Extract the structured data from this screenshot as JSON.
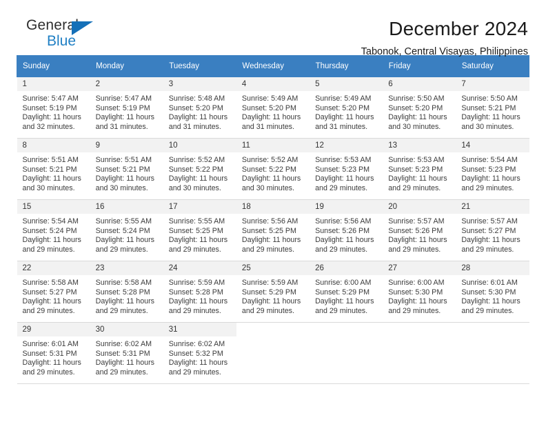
{
  "brand": {
    "name_line1": "General",
    "name_line2": "Blue",
    "accent_color": "#1570b8"
  },
  "header": {
    "title": "December 2024",
    "subtitle": "Tabonok, Central Visayas, Philippines"
  },
  "calendar": {
    "header_bg": "#3a7fc1",
    "daynum_bg": "#f2f2f2",
    "weekdays": [
      "Sunday",
      "Monday",
      "Tuesday",
      "Wednesday",
      "Thursday",
      "Friday",
      "Saturday"
    ],
    "weeks": [
      [
        {
          "day": "1",
          "sunrise": "Sunrise: 5:47 AM",
          "sunset": "Sunset: 5:19 PM",
          "daylight1": "Daylight: 11 hours",
          "daylight2": "and 32 minutes."
        },
        {
          "day": "2",
          "sunrise": "Sunrise: 5:47 AM",
          "sunset": "Sunset: 5:19 PM",
          "daylight1": "Daylight: 11 hours",
          "daylight2": "and 31 minutes."
        },
        {
          "day": "3",
          "sunrise": "Sunrise: 5:48 AM",
          "sunset": "Sunset: 5:20 PM",
          "daylight1": "Daylight: 11 hours",
          "daylight2": "and 31 minutes."
        },
        {
          "day": "4",
          "sunrise": "Sunrise: 5:49 AM",
          "sunset": "Sunset: 5:20 PM",
          "daylight1": "Daylight: 11 hours",
          "daylight2": "and 31 minutes."
        },
        {
          "day": "5",
          "sunrise": "Sunrise: 5:49 AM",
          "sunset": "Sunset: 5:20 PM",
          "daylight1": "Daylight: 11 hours",
          "daylight2": "and 31 minutes."
        },
        {
          "day": "6",
          "sunrise": "Sunrise: 5:50 AM",
          "sunset": "Sunset: 5:20 PM",
          "daylight1": "Daylight: 11 hours",
          "daylight2": "and 30 minutes."
        },
        {
          "day": "7",
          "sunrise": "Sunrise: 5:50 AM",
          "sunset": "Sunset: 5:21 PM",
          "daylight1": "Daylight: 11 hours",
          "daylight2": "and 30 minutes."
        }
      ],
      [
        {
          "day": "8",
          "sunrise": "Sunrise: 5:51 AM",
          "sunset": "Sunset: 5:21 PM",
          "daylight1": "Daylight: 11 hours",
          "daylight2": "and 30 minutes."
        },
        {
          "day": "9",
          "sunrise": "Sunrise: 5:51 AM",
          "sunset": "Sunset: 5:21 PM",
          "daylight1": "Daylight: 11 hours",
          "daylight2": "and 30 minutes."
        },
        {
          "day": "10",
          "sunrise": "Sunrise: 5:52 AM",
          "sunset": "Sunset: 5:22 PM",
          "daylight1": "Daylight: 11 hours",
          "daylight2": "and 30 minutes."
        },
        {
          "day": "11",
          "sunrise": "Sunrise: 5:52 AM",
          "sunset": "Sunset: 5:22 PM",
          "daylight1": "Daylight: 11 hours",
          "daylight2": "and 30 minutes."
        },
        {
          "day": "12",
          "sunrise": "Sunrise: 5:53 AM",
          "sunset": "Sunset: 5:23 PM",
          "daylight1": "Daylight: 11 hours",
          "daylight2": "and 29 minutes."
        },
        {
          "day": "13",
          "sunrise": "Sunrise: 5:53 AM",
          "sunset": "Sunset: 5:23 PM",
          "daylight1": "Daylight: 11 hours",
          "daylight2": "and 29 minutes."
        },
        {
          "day": "14",
          "sunrise": "Sunrise: 5:54 AM",
          "sunset": "Sunset: 5:23 PM",
          "daylight1": "Daylight: 11 hours",
          "daylight2": "and 29 minutes."
        }
      ],
      [
        {
          "day": "15",
          "sunrise": "Sunrise: 5:54 AM",
          "sunset": "Sunset: 5:24 PM",
          "daylight1": "Daylight: 11 hours",
          "daylight2": "and 29 minutes."
        },
        {
          "day": "16",
          "sunrise": "Sunrise: 5:55 AM",
          "sunset": "Sunset: 5:24 PM",
          "daylight1": "Daylight: 11 hours",
          "daylight2": "and 29 minutes."
        },
        {
          "day": "17",
          "sunrise": "Sunrise: 5:55 AM",
          "sunset": "Sunset: 5:25 PM",
          "daylight1": "Daylight: 11 hours",
          "daylight2": "and 29 minutes."
        },
        {
          "day": "18",
          "sunrise": "Sunrise: 5:56 AM",
          "sunset": "Sunset: 5:25 PM",
          "daylight1": "Daylight: 11 hours",
          "daylight2": "and 29 minutes."
        },
        {
          "day": "19",
          "sunrise": "Sunrise: 5:56 AM",
          "sunset": "Sunset: 5:26 PM",
          "daylight1": "Daylight: 11 hours",
          "daylight2": "and 29 minutes."
        },
        {
          "day": "20",
          "sunrise": "Sunrise: 5:57 AM",
          "sunset": "Sunset: 5:26 PM",
          "daylight1": "Daylight: 11 hours",
          "daylight2": "and 29 minutes."
        },
        {
          "day": "21",
          "sunrise": "Sunrise: 5:57 AM",
          "sunset": "Sunset: 5:27 PM",
          "daylight1": "Daylight: 11 hours",
          "daylight2": "and 29 minutes."
        }
      ],
      [
        {
          "day": "22",
          "sunrise": "Sunrise: 5:58 AM",
          "sunset": "Sunset: 5:27 PM",
          "daylight1": "Daylight: 11 hours",
          "daylight2": "and 29 minutes."
        },
        {
          "day": "23",
          "sunrise": "Sunrise: 5:58 AM",
          "sunset": "Sunset: 5:28 PM",
          "daylight1": "Daylight: 11 hours",
          "daylight2": "and 29 minutes."
        },
        {
          "day": "24",
          "sunrise": "Sunrise: 5:59 AM",
          "sunset": "Sunset: 5:28 PM",
          "daylight1": "Daylight: 11 hours",
          "daylight2": "and 29 minutes."
        },
        {
          "day": "25",
          "sunrise": "Sunrise: 5:59 AM",
          "sunset": "Sunset: 5:29 PM",
          "daylight1": "Daylight: 11 hours",
          "daylight2": "and 29 minutes."
        },
        {
          "day": "26",
          "sunrise": "Sunrise: 6:00 AM",
          "sunset": "Sunset: 5:29 PM",
          "daylight1": "Daylight: 11 hours",
          "daylight2": "and 29 minutes."
        },
        {
          "day": "27",
          "sunrise": "Sunrise: 6:00 AM",
          "sunset": "Sunset: 5:30 PM",
          "daylight1": "Daylight: 11 hours",
          "daylight2": "and 29 minutes."
        },
        {
          "day": "28",
          "sunrise": "Sunrise: 6:01 AM",
          "sunset": "Sunset: 5:30 PM",
          "daylight1": "Daylight: 11 hours",
          "daylight2": "and 29 minutes."
        }
      ],
      [
        {
          "day": "29",
          "sunrise": "Sunrise: 6:01 AM",
          "sunset": "Sunset: 5:31 PM",
          "daylight1": "Daylight: 11 hours",
          "daylight2": "and 29 minutes."
        },
        {
          "day": "30",
          "sunrise": "Sunrise: 6:02 AM",
          "sunset": "Sunset: 5:31 PM",
          "daylight1": "Daylight: 11 hours",
          "daylight2": "and 29 minutes."
        },
        {
          "day": "31",
          "sunrise": "Sunrise: 6:02 AM",
          "sunset": "Sunset: 5:32 PM",
          "daylight1": "Daylight: 11 hours",
          "daylight2": "and 29 minutes."
        },
        {
          "day": "",
          "sunrise": "",
          "sunset": "",
          "daylight1": "",
          "daylight2": ""
        },
        {
          "day": "",
          "sunrise": "",
          "sunset": "",
          "daylight1": "",
          "daylight2": ""
        },
        {
          "day": "",
          "sunrise": "",
          "sunset": "",
          "daylight1": "",
          "daylight2": ""
        },
        {
          "day": "",
          "sunrise": "",
          "sunset": "",
          "daylight1": "",
          "daylight2": ""
        }
      ]
    ]
  }
}
